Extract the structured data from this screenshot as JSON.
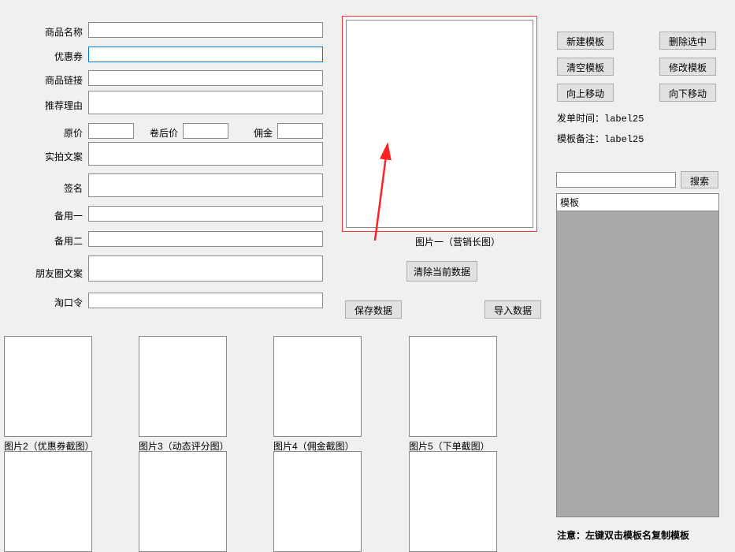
{
  "form": {
    "product_name": {
      "label": "商品名称",
      "value": ""
    },
    "coupon": {
      "label": "优惠券",
      "value": ""
    },
    "product_link": {
      "label": "商品链接",
      "value": ""
    },
    "recommend_reason": {
      "label": "推荐理由",
      "value": ""
    },
    "original_price": {
      "label": "原价",
      "value": ""
    },
    "after_coupon_price": {
      "label": "卷后价",
      "value": ""
    },
    "commission": {
      "label": "佣金",
      "value": ""
    },
    "real_shot_copy": {
      "label": "实拍文案",
      "value": ""
    },
    "signature": {
      "label": "签名",
      "value": ""
    },
    "spare1": {
      "label": "备用一",
      "value": ""
    },
    "spare2": {
      "label": "备用二",
      "value": ""
    },
    "moments_copy": {
      "label": "朋友圈文案",
      "value": ""
    },
    "tao_password": {
      "label": "淘口令",
      "value": ""
    }
  },
  "image_labels": {
    "img1": "图片一（营销长图）",
    "img2": "图片2（优惠券截图）",
    "img3": "图片3（动态评分图）",
    "img4": "图片4（佣金截图）",
    "img5": "图片5（下单截图）"
  },
  "buttons": {
    "clear_current": "清除当前数据",
    "save_data": "保存数据",
    "import_data": "导入数据",
    "new_template": "新建模板",
    "delete_selected": "删除选中",
    "clear_template": "清空模板",
    "modify_template": "修改模板",
    "move_up": "向上移动",
    "move_down": "向下移动",
    "search": "搜索"
  },
  "info": {
    "post_time_label": "发单时间：",
    "post_time_value": "label25",
    "template_note_label": "模板备注：",
    "template_note_value": "label25"
  },
  "search": {
    "value": ""
  },
  "list": {
    "header": "模板"
  },
  "note": "注意：左键双击模板名复制模板"
}
